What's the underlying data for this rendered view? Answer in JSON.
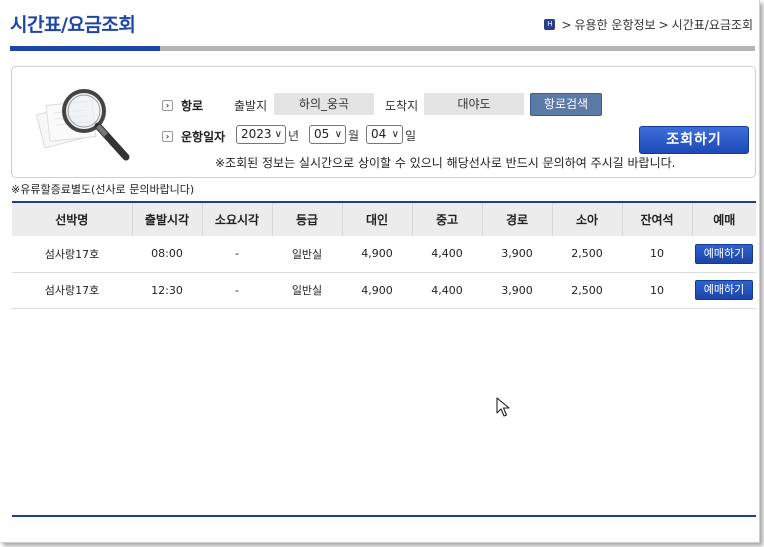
{
  "header": {
    "title": "시간표/요금조회",
    "breadcrumb": [
      "유용한 운항정보",
      "시간표/요금조회"
    ],
    "breadcrumb_sep": ">"
  },
  "search": {
    "route_label": "항로",
    "departure_label": "출발지",
    "departure_value": "하의_웅곡",
    "arrival_label": "도착지",
    "arrival_value": "대야도",
    "route_search_button": "항로검색",
    "date_label": "운항일자",
    "year": "2023",
    "year_unit": "년",
    "month": "05",
    "month_unit": "월",
    "day": "04",
    "day_unit": "일",
    "query_button": "조회하기",
    "notice": "※조회된 정보는 실시간으로 상이할 수 있으니 해당선사로 반드시 문의하여 주시길 바랍니다."
  },
  "fare_note": "※유류할증료별도(선사로 문의바랍니다)",
  "table": {
    "headers": [
      "선박명",
      "출발시각",
      "소요시각",
      "등급",
      "대인",
      "중고",
      "경로",
      "소아",
      "잔여석",
      "예매"
    ],
    "rows": [
      {
        "ship": "섬사랑17호",
        "depart": "08:00",
        "duration": "-",
        "grade": "일반실",
        "adult": "4,900",
        "teen": "4,400",
        "senior": "3,900",
        "child": "2,500",
        "seats": "10",
        "book": "예매하기"
      },
      {
        "ship": "섬사랑17호",
        "depart": "12:30",
        "duration": "-",
        "grade": "일반실",
        "adult": "4,900",
        "teen": "4,400",
        "senior": "3,900",
        "child": "2,500",
        "seats": "10",
        "book": "예매하기"
      }
    ]
  },
  "colors": {
    "accent": "#1f45a8",
    "button_blue": "#1d49b5",
    "route_button": "#5b7aa6"
  },
  "icons": [
    "home-icon",
    "bullet-arrow-icon",
    "magnifier-icon",
    "chevron-down-icon",
    "mouse-cursor-icon"
  ]
}
